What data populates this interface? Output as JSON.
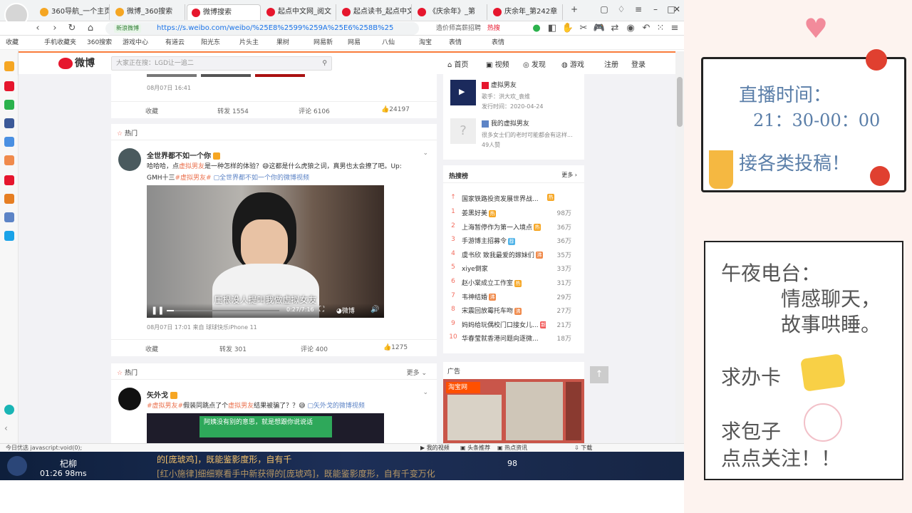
{
  "browser": {
    "tabs": [
      {
        "label": "360导航_一个主页",
        "color": "#f5a623"
      },
      {
        "label": "微博_360搜索",
        "color": "#f5a623"
      },
      {
        "label": "微博搜索",
        "color": "#e6162d"
      },
      {
        "label": "起点中文网_阅文",
        "color": "#e6162d"
      },
      {
        "label": "起点读书_起点中文",
        "color": "#e6162d"
      },
      {
        "label": "《庆余年》_第",
        "color": "#e6162d"
      },
      {
        "label": "庆余年_第242章",
        "color": "#e6162d"
      }
    ],
    "url": "https://s.weibo.com/weibo/%25E8%2599%259A%25E6%258B%25",
    "secure_badge": "新浪微博",
    "search_placeholder": "造价师高薪招聘",
    "hot_label": "热搜",
    "bookmarks": [
      "收藏",
      "手机收藏夹",
      "360搜索",
      "游戏中心",
      "有道云",
      "阳光东",
      "片头主",
      "果树",
      "网易新",
      "网易",
      "八仙",
      "淘宝",
      "表情"
    ]
  },
  "weibo": {
    "logo": "微博",
    "search_placeholder": "大家正在搜：LGD让一追二",
    "nav": [
      "首页",
      "视频",
      "发现",
      "游戏",
      "注册",
      "登录"
    ],
    "post0": {
      "time": "08月07日 16:41",
      "actions": [
        "收藏",
        "转发 1554",
        "评论 6106",
        "24197"
      ]
    },
    "hot_label_1": "热门",
    "post1": {
      "author": "全世界都不如一个你",
      "text_a": "哈哈哈，点",
      "tag_a": "虚拟男友",
      "text_b": "是一种怎样的体验？",
      "text_c": "这都是什么虎狼之词，真男也太会撩了吧。Up:",
      "text_d": "GMH十三",
      "tag_b": "#虚拟男友#",
      "video_link": "全世界都不如一个你的微博视频",
      "video_subtitle": "压根没人提叫我做虚拟女友",
      "video_time": "0:27/7:16",
      "video_brand": "微博",
      "meta": "08月07日 17:01  来自 球球快乐iPhone 11",
      "actions": [
        "收藏",
        "转发 301",
        "评论 400",
        "1275"
      ]
    },
    "hot_label_2": "热门",
    "more_label": "更多",
    "post2": {
      "author": "矢外戈",
      "tag_a": "#虚拟男友#",
      "text_a": "假装同跳点了个",
      "tag_b": "虚拟男友",
      "text_b": "结果被骗了？？",
      "video_link": "矢外戈的微博视频",
      "preview_caption": "阿姨没有别的意思，就是想跟你说说话"
    }
  },
  "sidebar_right": {
    "item1": {
      "title": "虚拟男友",
      "meta1": "歌手：洪大欢_袁维",
      "meta2": "发行时间：2020-04-24"
    },
    "item2": {
      "title": "我的虚拟男友",
      "desc": "很多女士们的老时可能都会有这样...",
      "count": "49人赞"
    },
    "hot_title": "热搜榜",
    "hot_more": "更多",
    "hot_top": "国家铁路投资发展世界战...",
    "hot_list": [
      {
        "rank": "1",
        "title": "姜黑好美",
        "num": "98万",
        "badge": "热",
        "badge_color": "#f6a623"
      },
      {
        "rank": "2",
        "title": "上海暂停作为第一入境点",
        "num": "36万",
        "badge": "热",
        "badge_color": "#f6a623"
      },
      {
        "rank": "3",
        "title": "手游博主招募令",
        "num": "36万",
        "badge": "荐",
        "badge_color": "#4fb3e8"
      },
      {
        "rank": "4",
        "title": "虞书欣 致我最爱的嫁妹们",
        "num": "35万",
        "badge": "沸",
        "badge_color": "#f08a4b"
      },
      {
        "rank": "5",
        "title": "xiye倒家",
        "num": "33万",
        "badge": "",
        "badge_color": ""
      },
      {
        "rank": "6",
        "title": "赵小棠成立工作室",
        "num": "31万",
        "badge": "热",
        "badge_color": "#f6a623"
      },
      {
        "rank": "7",
        "title": "韦神结婚",
        "num": "29万",
        "badge": "沸",
        "badge_color": "#f08a4b"
      },
      {
        "rank": "8",
        "title": "宋震回放霉托车吻",
        "num": "27万",
        "badge": "沸",
        "badge_color": "#f08a4b"
      },
      {
        "rank": "9",
        "title": "妈妈给玩偶校门口接女儿...",
        "num": "21万",
        "badge": "新",
        "badge_color": "#f25a5a"
      },
      {
        "rank": "10",
        "title": "华春莹就香港问题向逐微...",
        "num": "18万",
        "badge": "",
        "badge_color": ""
      }
    ],
    "ad_label": "广告",
    "ad_brand": "淘宝网"
  },
  "statusbar": {
    "left": "今日优选  javascript:void(0);",
    "items": [
      "我的视频",
      "头条推荐",
      "热点资讯",
      "下载"
    ]
  },
  "game": {
    "line1": "的[庞琥鸡]，既能鉴影度形，自有千",
    "line2": "[红小施律]细细察看手中新获得的[庞琥鸡]，既能鉴影度形，自有千变万化",
    "name": "杞柳",
    "time": "01:26",
    "ms": "98ms",
    "num": "98",
    "extra": "变万化"
  },
  "overlay": {
    "line1": "直播时间：",
    "line2": "21：30-00：00",
    "line3": "接各类投稿！",
    "p1": "午夜电台：",
    "p2": "情感聊天，",
    "p3": "故事哄睡。",
    "p4": "求办卡",
    "p5": "求包子",
    "p6": "点点关注！！"
  }
}
